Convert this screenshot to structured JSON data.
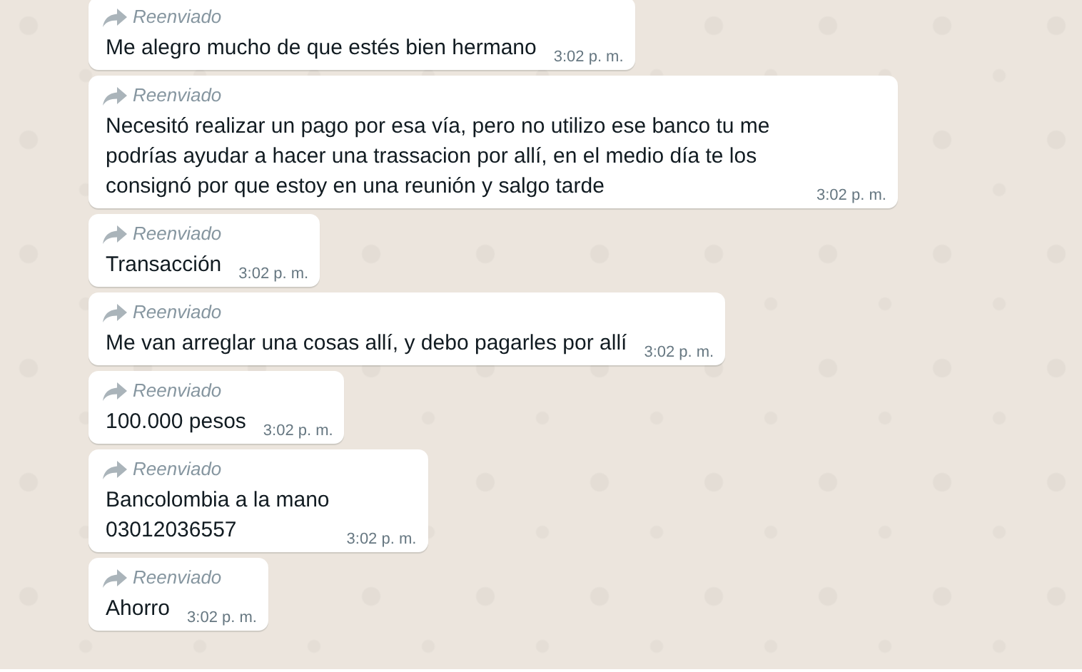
{
  "messages": [
    {
      "forwarded_label": "Reenviado",
      "text": "Me alegro mucho de que estés bien hermano",
      "time": "3:02 p. m."
    },
    {
      "forwarded_label": "Reenviado",
      "text": "Necesitó realizar un pago por esa vía, pero no utilizo ese banco tu me podrías ayudar a hacer una trassacion por allí, en el medio día te los consignó por que estoy en una reunión y salgo tarde",
      "time": "3:02 p. m."
    },
    {
      "forwarded_label": "Reenviado",
      "text": "Transacción",
      "time": "3:02 p. m."
    },
    {
      "forwarded_label": "Reenviado",
      "text": "Me van arreglar una cosas allí, y debo pagarles por allí",
      "time": "3:02 p. m."
    },
    {
      "forwarded_label": "Reenviado",
      "text": "100.000 pesos",
      "time": "3:02 p. m."
    },
    {
      "forwarded_label": "Reenviado",
      "text": "Bancolombia a la mano\n03012036557",
      "time": "3:02 p. m."
    },
    {
      "forwarded_label": "Reenviado",
      "text": "Ahorro",
      "time": "3:02 p. m."
    }
  ]
}
